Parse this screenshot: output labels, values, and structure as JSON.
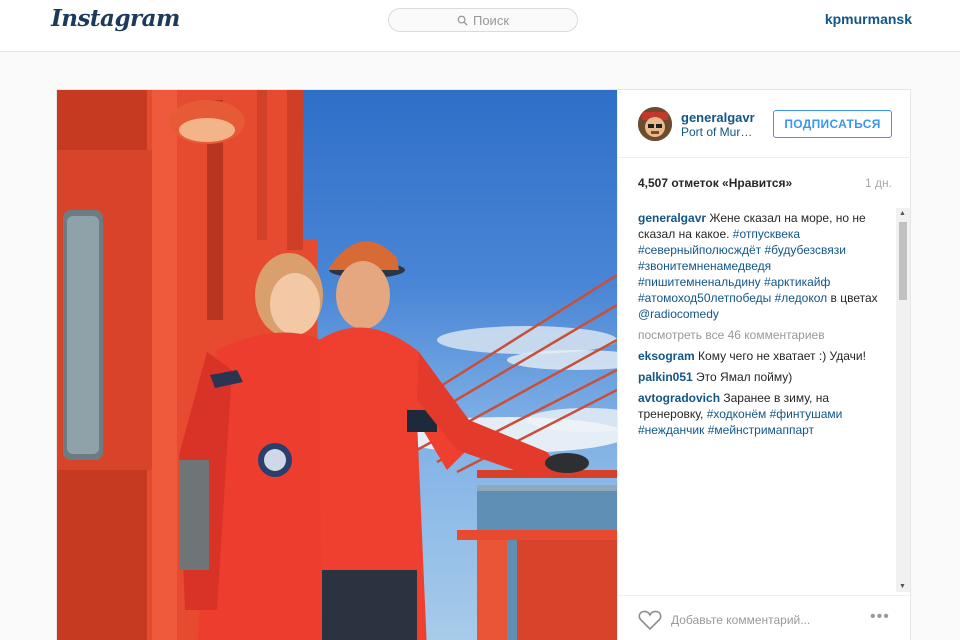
{
  "header": {
    "logo": "Instagram",
    "search_placeholder": "Поиск",
    "username": "kpmurmansk"
  },
  "post": {
    "author": "generalgavr",
    "location": "Port of Murmansk",
    "follow_label": "ПОДПИСАТЬСЯ",
    "likes": "4,507 отметок «Нравится»",
    "time": "1 дн.",
    "caption_author": "generalgavr",
    "caption_text": "Жене сказал на море, но не сказал на какое.",
    "caption_tags": [
      "#отпусквека",
      "#северныйполюсждёт",
      "#будубезсвязи",
      "#звонитемненамедведя",
      "#пишитемненальдину",
      "#арктикайф",
      "#атомоход50летпобеды",
      "#ледокол"
    ],
    "caption_mid": "в цветах",
    "caption_mention": "@radiocomedy",
    "view_all": "посмотреть все 46 комментариев",
    "comments": [
      {
        "user": "eksogram",
        "text": "Кому чего не хватает :) Удачи!",
        "tags": []
      },
      {
        "user": "palkin051",
        "text": "Это Ямал пойму)",
        "tags": []
      },
      {
        "user": "avtogradovich",
        "text": "Заранее в зиму, на тренеровку,",
        "tags": [
          "#ходконём",
          "#финтушами",
          "#нежданчик",
          "#мейнстримаппарт"
        ]
      }
    ],
    "add_comment_placeholder": "Добавьте комментарий...",
    "more_label": "•••"
  },
  "colors": {
    "link": "#125688",
    "follow": "#3897f0",
    "ship_red": "#e8442e"
  }
}
